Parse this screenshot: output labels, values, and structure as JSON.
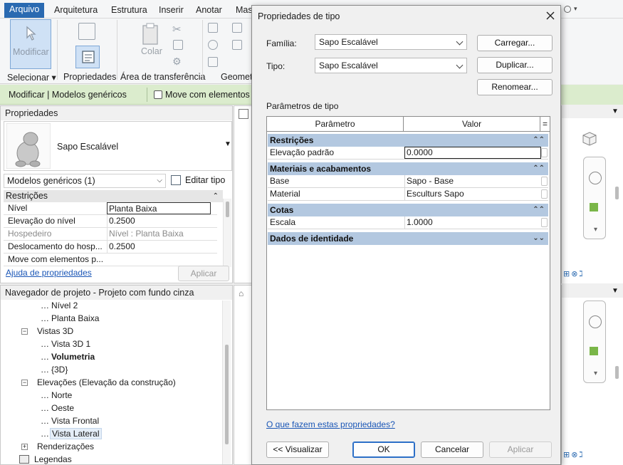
{
  "menu": {
    "tabs": [
      "Arquivo",
      "Arquitetura",
      "Estrutura",
      "Inserir",
      "Anotar",
      "Mas"
    ]
  },
  "ribbon": {
    "modify_label": "Modificar",
    "paste_label": "Colar",
    "panels": {
      "select": "Selecionar ▾",
      "properties": "Propriedades",
      "clipboard": "Área de transferência",
      "geometry": "Geomet"
    }
  },
  "context_bar": {
    "title": "Modificar | Modelos genéricos",
    "option_label": "Move com elementos p"
  },
  "properties_panel": {
    "title": "Propriedades",
    "type_name": "Sapo Escalável",
    "filter": "Modelos genéricos (1)",
    "edit_type": "Editar tipo",
    "section": "Restrições",
    "rows": [
      {
        "key": "Nível",
        "value": "Planta Baixa"
      },
      {
        "key": "Elevação do nível",
        "value": "0.2500"
      },
      {
        "key": "Hospedeiro",
        "value": "Nível : Planta Baixa"
      },
      {
        "key": "Deslocamento do hosp...",
        "value": "0.2500"
      },
      {
        "key": "Move com elementos p...",
        "value": ""
      }
    ],
    "help_link": "Ajuda de propriedades",
    "apply": "Aplicar"
  },
  "project_browser": {
    "title": "Navegador de projeto - Projeto com fundo cinza",
    "items": [
      {
        "label": "Nível 2"
      },
      {
        "label": "Planta Baixa"
      },
      {
        "label": "Vistas 3D"
      },
      {
        "label": "Vista 3D 1"
      },
      {
        "label": "Volumetria"
      },
      {
        "label": "{3D}"
      },
      {
        "label": "Elevações (Elevação da construção)"
      },
      {
        "label": "Norte"
      },
      {
        "label": "Oeste"
      },
      {
        "label": "Vista Frontal"
      },
      {
        "label": "Vista Lateral"
      },
      {
        "label": "Renderizações"
      },
      {
        "label": "Legendas"
      }
    ]
  },
  "dialog": {
    "title": "Propriedades de tipo",
    "family_label": "Família:",
    "family_value": "Sapo Escalável",
    "type_label": "Tipo:",
    "type_value": "Sapo Escalável",
    "btn_load": "Carregar...",
    "btn_duplicate": "Duplicar...",
    "btn_rename": "Renomear...",
    "params_label": "Parâmetros de tipo",
    "col_param": "Parâmetro",
    "col_value": "Valor",
    "col_eq": "=",
    "sections": [
      {
        "name": "Restrições",
        "rows": [
          {
            "key": "Elevação padrão",
            "value": "0.0000"
          }
        ]
      },
      {
        "name": "Materiais e acabamentos",
        "rows": [
          {
            "key": "Base",
            "value": "Sapo - Base"
          },
          {
            "key": "Material",
            "value": "Esculturs Sapo"
          }
        ]
      },
      {
        "name": "Cotas",
        "rows": [
          {
            "key": "Escala",
            "value": "1.0000"
          }
        ]
      },
      {
        "name": "Dados de identidade",
        "rows": []
      }
    ],
    "help_link": "O que fazem estas propriedades?",
    "btn_preview": "<< Visualizar",
    "btn_ok": "OK",
    "btn_cancel": "Cancelar",
    "btn_apply": "Aplicar"
  },
  "colors": {
    "accent": "#2a6ab1",
    "context_bar": "#dbeccd",
    "section_header": "#b3c8e0"
  }
}
